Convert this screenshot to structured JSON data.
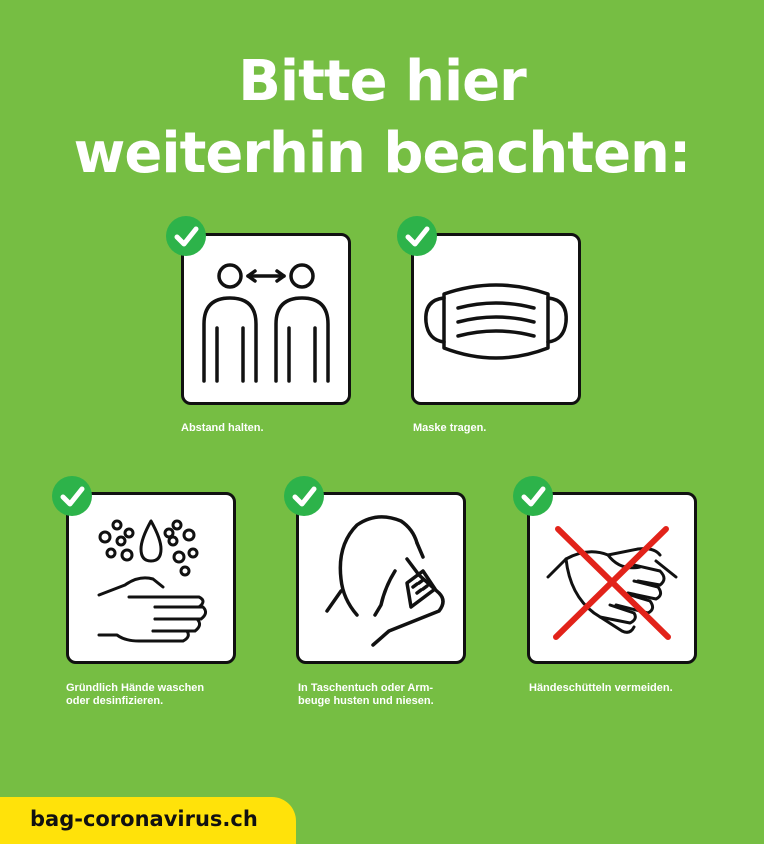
{
  "title": {
    "line1": "Bitte hier",
    "line2": "weiterhin beachten:"
  },
  "items": [
    {
      "icon": "distance-icon",
      "caption": [
        "Abstand halten."
      ],
      "status": "check"
    },
    {
      "icon": "mask-icon",
      "caption": [
        "Maske tragen."
      ],
      "status": "check"
    },
    {
      "icon": "handwash-icon",
      "caption": [
        "Gründlich Hände waschen",
        "oder desinfizieren."
      ],
      "status": "check"
    },
    {
      "icon": "cough-elbow-icon",
      "caption": [
        "In Taschentuch oder Arm-",
        "beuge husten und niesen."
      ],
      "status": "check"
    },
    {
      "icon": "no-handshake-icon",
      "caption": [
        "Händeschütteln vermeiden."
      ],
      "status": "check"
    }
  ],
  "footer": {
    "url": "bag-coronavirus.ch"
  },
  "colors": {
    "background": "#76be43",
    "check": "#2db34a",
    "footer_badge": "#ffe20a",
    "cross": "#e2231a"
  }
}
